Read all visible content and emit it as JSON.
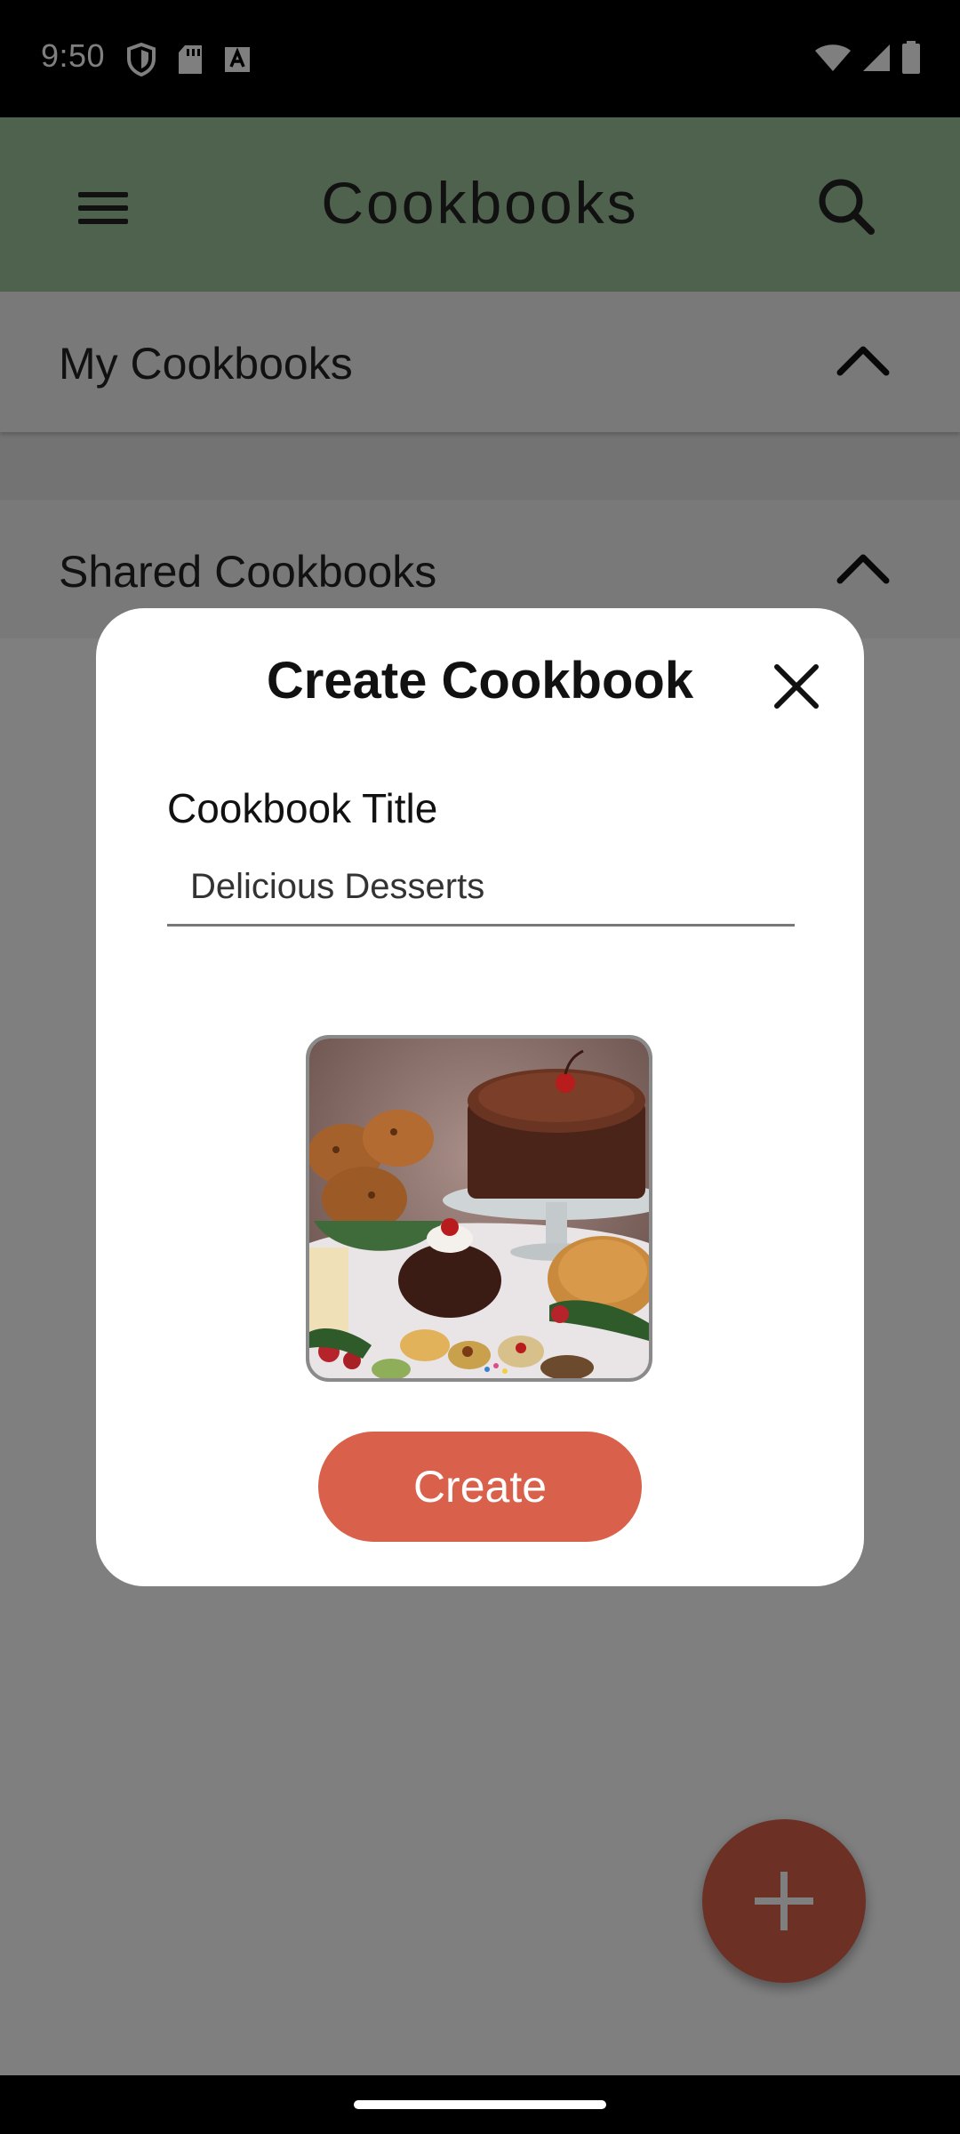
{
  "status_bar": {
    "time": "9:50",
    "left_icons": [
      "shield-icon",
      "sd-card-icon",
      "a11y-text-icon"
    ],
    "right_icons": [
      "wifi-icon",
      "cell-signal-icon",
      "battery-icon"
    ]
  },
  "app_bar": {
    "title": "Cookbooks",
    "menu_icon": "menu-icon",
    "search_icon": "search-icon",
    "color": "#9dc49b"
  },
  "sections": [
    {
      "label": "My Cookbooks",
      "icon": "chevron-up-icon",
      "expanded": true
    },
    {
      "label": "Shared Cookbooks",
      "icon": "chevron-up-icon",
      "expanded": true
    }
  ],
  "fab": {
    "icon": "plus-icon",
    "color": "#d9604a"
  },
  "dialog": {
    "title": "Create Cookbook",
    "close_icon": "close-icon",
    "field_label": "Cookbook Title",
    "field_value": "Delicious Desserts",
    "image_icon": "dessert-cover-image",
    "create_label": "Create",
    "accent_color": "#d9604a"
  }
}
